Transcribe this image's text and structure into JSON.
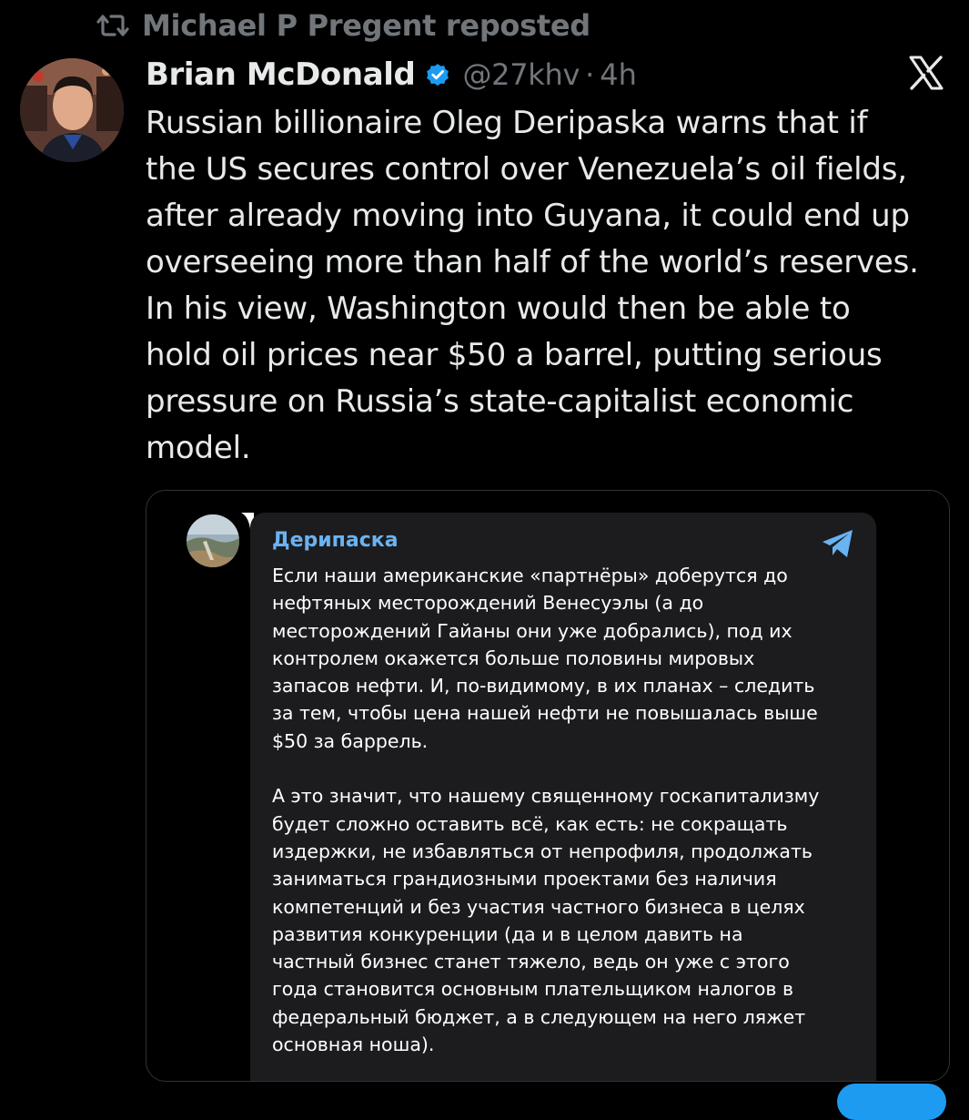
{
  "repost": {
    "icon": "repost-icon",
    "text": "Michael P Pregent reposted"
  },
  "author": {
    "name": "Brian McDonald",
    "verified_icon": "verified-badge-icon",
    "handle": "@27khv",
    "separator": "·",
    "time": "4h"
  },
  "brand_icon": "x-logo-icon",
  "tweet": {
    "lines": [
      "Russian billionaire Oleg Deripaska warns that if",
      "the US secures control over Venezuela’s oil fields,",
      "after already moving into Guyana,  it could end up",
      "overseeing more than half of the world’s reserves.",
      "In his view, Washington would then be able to",
      "hold oil prices near $50 a barrel, putting serious",
      "pressure on Russia’s state-capitalist economic",
      "model."
    ]
  },
  "embed": {
    "channel_name": "Дерипаска",
    "app_icon": "telegram-icon",
    "paragraph1": [
      "Если наши американские «партнёры» доберутся до",
      "нефтяных месторождений Венесуэлы (а до",
      "месторождений Гайаны они уже добрались), под их",
      "контролем окажется больше половины мировых",
      "запасов нефти. И, по-видимому, в их планах – следить",
      "за тем, чтобы цена нашей нефти не повышалась выше",
      "$50 за баррель."
    ],
    "paragraph2": [
      "А это значит, что нашему священному госкапитализму",
      "будет сложно оставить всё, как есть: не сокращать",
      "издержки, не избавляться от непрофиля, продолжать",
      "заниматься грандиозными проектами без наличия",
      "компетенций и без участия частного бизнеса в целях",
      "развития конкуренции (да и в целом давить на",
      "частный бизнес станет тяжело, ведь он уже с этого",
      "года становится основным плательщиком налогов в",
      "федеральный бюджет, а в следующем на него ляжет",
      "основная ноша)."
    ]
  },
  "colors": {
    "background": "#000000",
    "text_primary": "#e7e9ea",
    "text_secondary": "#71767b",
    "verified_blue": "#1d9bf0",
    "telegram_bubble": "#1c1c1e",
    "telegram_name": "#6ab3f3"
  }
}
